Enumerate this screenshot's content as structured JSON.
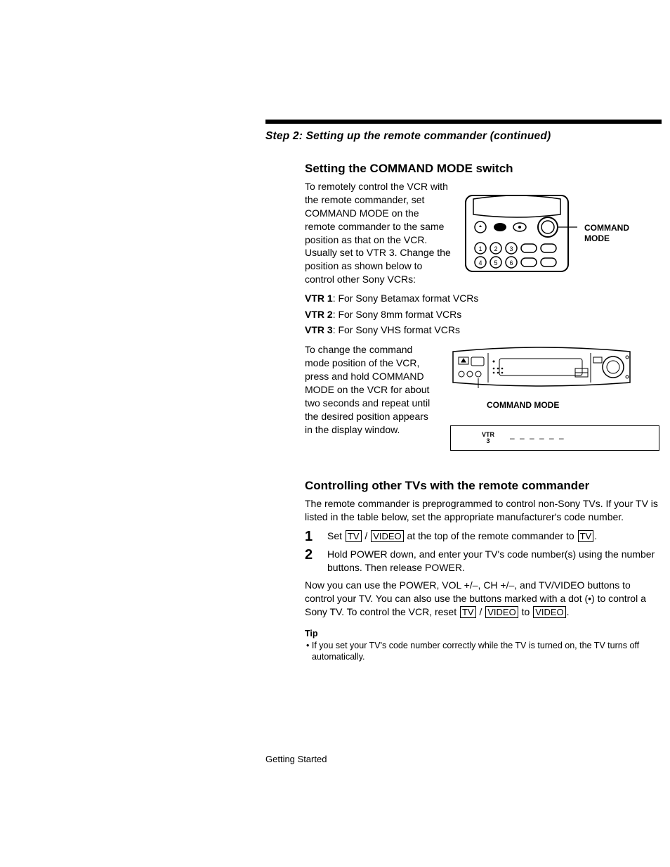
{
  "header": {
    "step_title": "Step 2: Setting up the remote commander (continued)"
  },
  "section1": {
    "heading": "Setting the COMMAND MODE switch",
    "para1": "To remotely control the VCR with the remote commander, set COMMAND MODE on the remote commander to the same position as that on the VCR. Usually set to VTR 3. Change the position as shown below to control other Sony VCRs:",
    "remote_label_line1": "COMMAND",
    "remote_label_line2": "MODE",
    "vtr_items": [
      {
        "label": "VTR 1",
        "text": ": For Sony Betamax format VCRs"
      },
      {
        "label": "VTR 2",
        "text": ": For Sony 8mm format VCRs"
      },
      {
        "label": "VTR 3",
        "text": ": For Sony VHS format VCRs"
      }
    ],
    "para2": "To change the command mode position of the VCR, press and hold COMMAND MODE on the VCR for about two seconds and repeat until the desired position appears in the display window.",
    "vcr_caption": "COMMAND MODE",
    "display": {
      "vtr_top": "VTR",
      "vtr_bottom": "3",
      "dashes": "– –   – –   – –"
    }
  },
  "section2": {
    "heading": "Controlling other TVs with the remote commander",
    "intro": "The remote commander is preprogrammed to control non-Sony TVs. If your TV is listed in the table below, set the appropriate manufacturer's code number.",
    "step1_num": "1",
    "step1_a": "Set ",
    "step1_tv": "TV",
    "step1_slash": " / ",
    "step1_video": "VIDEO",
    "step1_b": " at the top of the remote commander to ",
    "step1_tv2": "TV",
    "step1_c": ".",
    "step2_num": "2",
    "step2": "Hold POWER down, and enter your TV's code number(s) using the number buttons. Then release POWER.",
    "after_a": "Now you can use the POWER, VOL +/–, CH +/–, and TV/VIDEO buttons to control your TV. You can also use the buttons marked with a dot (•) to control a Sony TV. To control the VCR, reset ",
    "after_tv": "TV",
    "after_slash": " / ",
    "after_video": "VIDEO",
    "after_to": " to ",
    "after_video2": "VIDEO",
    "after_b": ".",
    "tip_heading": "Tip",
    "tip_body": "• If you set your TV's code number correctly while the TV is turned on, the TV turns off automatically."
  },
  "footer": {
    "text": "Getting Started"
  }
}
